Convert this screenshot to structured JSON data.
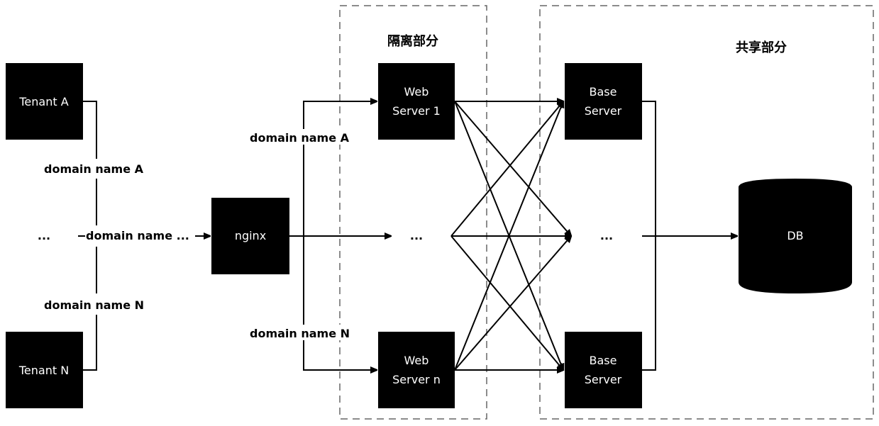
{
  "regions": {
    "isolated_title": "隔离部分",
    "shared_title": "共享部分"
  },
  "tenants": [
    {
      "label": "Tenant A"
    },
    {
      "label": "Tenant N"
    }
  ],
  "tenant_ellipsis": "...",
  "domain_labels": {
    "left_a": "domain name A",
    "left_mid": "domain name ...",
    "left_n": "domain name N",
    "right_a": "domain name A",
    "right_n": "domain name N"
  },
  "nginx": {
    "label": "nginx"
  },
  "web_servers": [
    {
      "line1": "Web",
      "line2": "Server 1"
    },
    {
      "line1": "Web",
      "line2": "Server n"
    }
  ],
  "web_ellipsis": "...",
  "base_servers": [
    {
      "line1": "Base",
      "line2": "Server"
    },
    {
      "line1": "Base",
      "line2": "Server"
    }
  ],
  "base_ellipsis": "...",
  "db": {
    "label": "DB"
  },
  "colors": {
    "node_fill": "#000000",
    "node_text": "#ffffff",
    "region_border": "#666666"
  }
}
